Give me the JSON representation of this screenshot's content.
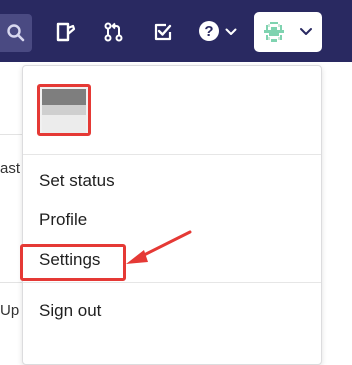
{
  "topbar": {
    "icons": [
      "search-icon",
      "snippet-icon",
      "merge-request-icon",
      "todo-icon",
      "help-icon",
      "chevron-down-icon"
    ],
    "background_color": "#292961"
  },
  "background_page": {
    "text_fragment_1": "ast",
    "text_fragment_2": "Up"
  },
  "user_menu": {
    "avatar_icon": "identicon-avatar",
    "items": [
      {
        "label": "Set status"
      },
      {
        "label": "Profile"
      },
      {
        "label": "Settings"
      },
      {
        "label": "Sign out"
      }
    ],
    "annotation_color": "#e53935"
  }
}
